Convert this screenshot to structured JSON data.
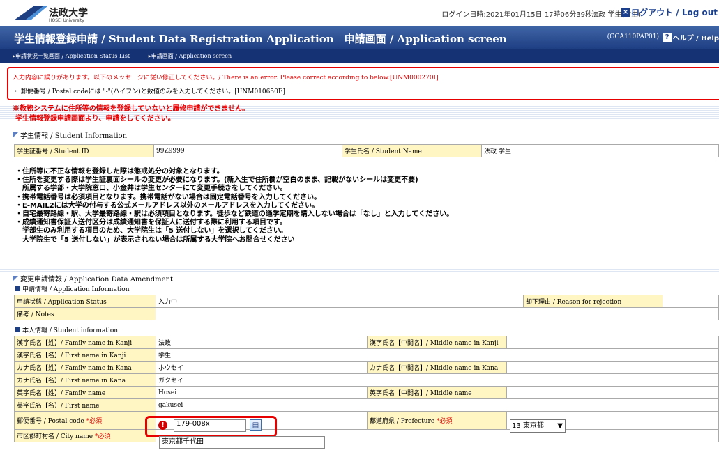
{
  "header": {
    "logo_text": "法政大学",
    "logo_sub": "HOSEI University",
    "login_info": "ログイン日時:2021年01月15日 17時06分39秒",
    "user_name": "法政 学生(学生)",
    "logout_label": "ログアウト / Log out"
  },
  "titlebar": {
    "title": "学生情報登録申請 / Student Data Registration Application　申請画面 / Application screen",
    "screen_id": "(GGA110PAP01)",
    "help_label": "ヘルプ / Help"
  },
  "breadcrumb": {
    "items": [
      "申請状況一覧画面 / Application Status List",
      "申請画面 / Application screen"
    ]
  },
  "error": {
    "main": "入力内容に誤りがあります。以下のメッセージに従い修正してください。/ There is an error. Please correct according to below.[UNM000270I]",
    "detail": "・ 郵便番号 / Postal codeには \"-\"(ハイフン)と数値のみを入力してください。[UNM010650E]"
  },
  "warning": {
    "line1": "※教務システムに住所等の情報を登録していないと履修申請ができません。",
    "line2": "学生情報登録申請画面より、申請をしてください。"
  },
  "student_info": {
    "heading": "学生情報 / Student Information",
    "id_label": "学生証番号 / Student ID",
    "id_value": "99Z9999",
    "name_label": "学生氏名 / Student Name",
    "name_value": "法政 学生"
  },
  "notes": [
    "・住所等に不正な情報を登録した際は懲戒処分の対象となります。",
    "・住所を変更する際は学生証裏面シールの変更が必要になります。(新入生で住所欄が空白のまま、記載がないシールは変更不要)",
    "　所属する学部・大学院窓口、小金井は学生センターにて変更手続きをしてください。",
    "・携帯電話番号は必須項目となります。携帯電話がない場合は固定電話番号を入力してください。",
    "・E-MAIL2には大学の付与する公式メールアドレス以外のメールアドレスを入力してください。",
    "・自宅最寄路線・駅、大学最寄路線・駅は必須項目となります。徒歩など鉄道の通学定期を購入しない場合は「なし」と入力してください。",
    "・成績通知書保証人送付区分は成績通知書を保証人に送付する際に利用する項目です。",
    "　学部生のみ利用する項目のため、大学院生は「5 送付しない」を選択してください。",
    "　大学院生で「5 送付しない」が表示されない場合は所属する大学院へお問合せください"
  ],
  "amendment": {
    "heading": "変更申請情報 / Application Data Amendment",
    "app_info_heading": "申請情報 / Application Information",
    "status_label": "申請状態 / Application Status",
    "status_value": "入力中",
    "rejection_label": "却下理由 / Reason for rejection",
    "notes_label": "備考 / Notes",
    "personal_heading": "本人情報 / Student information"
  },
  "personal": {
    "kanji_family_label": "漢字氏名【姓】/ Family name in Kanji",
    "kanji_family_value": "法政",
    "kanji_middle_label": "漢字氏名【中間名】/ Middle name in Kanji",
    "kanji_first_label": "漢字氏名【名】/ First name in Kanji",
    "kanji_first_value": "学生",
    "kana_family_label": "カナ氏名【姓】/ Family name in Kana",
    "kana_family_value": "ホウセイ",
    "kana_middle_label": "カナ氏名【中間名】/ Middle name in Kana",
    "kana_first_label": "カナ氏名【名】/ First name in Kana",
    "kana_first_value": "ガクセイ",
    "en_family_label": "英字氏名【姓】/ Family name",
    "en_family_value": "Hosei",
    "en_middle_label": "英字氏名【中間名】/ Middle name",
    "en_first_label": "英字氏名【名】/ First name",
    "en_first_value": "gakusei",
    "postal_label": "郵便番号 / Postal code ",
    "required_mark": "*必須",
    "postal_value": "179-008x",
    "prefecture_label": "都道府県 / Prefecture ",
    "prefecture_value": "13 東京都",
    "city_label": "市区郡町村名 / City name ",
    "city_value": "東京都千代田"
  },
  "colors": {
    "title_bg": "#1f3f83",
    "error": "#e60000",
    "label_bg": "#fff6c4"
  }
}
